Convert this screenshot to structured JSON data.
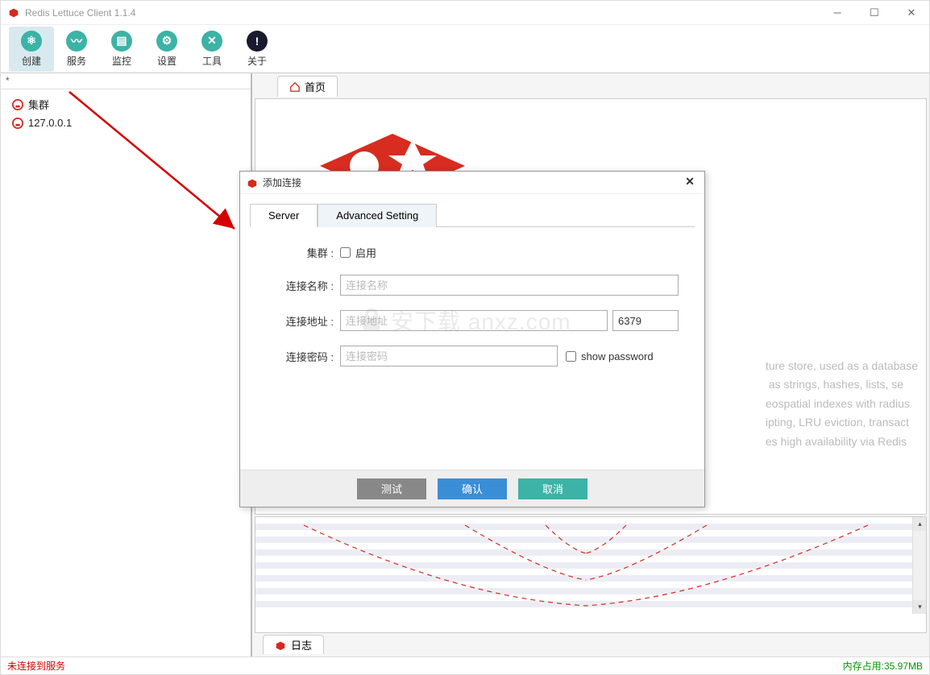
{
  "title": "Redis Lettuce Client 1.1.4",
  "toolbar": [
    {
      "id": "create",
      "label": "创建",
      "active": true
    },
    {
      "id": "service",
      "label": "服务",
      "active": false
    },
    {
      "id": "monitor",
      "label": "监控",
      "active": false
    },
    {
      "id": "settings",
      "label": "设置",
      "active": false
    },
    {
      "id": "tools",
      "label": "工具",
      "active": false
    },
    {
      "id": "about",
      "label": "关于",
      "active": false
    }
  ],
  "sidebar": {
    "header": "*",
    "items": [
      {
        "label": "集群"
      },
      {
        "label": "127.0.0.1"
      }
    ]
  },
  "tabs": {
    "home": "首页",
    "log": "日志"
  },
  "desc_lines": [
    "ture store, used as a database",
    " as strings, hashes, lists, se",
    "eospatial indexes with radius ",
    "ipting, LRU eviction, transact",
    "es high availability via Redis"
  ],
  "dialog": {
    "title": "添加连接",
    "tabs": {
      "server": "Server",
      "advanced": "Advanced Setting"
    },
    "labels": {
      "cluster": "集群 :",
      "enable": "启用",
      "conn_name": "连接名称 :",
      "conn_addr": "连接地址 :",
      "conn_pwd": "连接密码 :",
      "show_pwd": "show password"
    },
    "placeholders": {
      "name": "连接名称",
      "addr": "连接地址",
      "pwd": "连接密码"
    },
    "port": "6379",
    "buttons": {
      "test": "测试",
      "ok": "确认",
      "cancel": "取消"
    }
  },
  "status": {
    "left": "未连接到服务",
    "right": "内存占用:35.97MB"
  },
  "watermark": "安下载 anxz.com"
}
